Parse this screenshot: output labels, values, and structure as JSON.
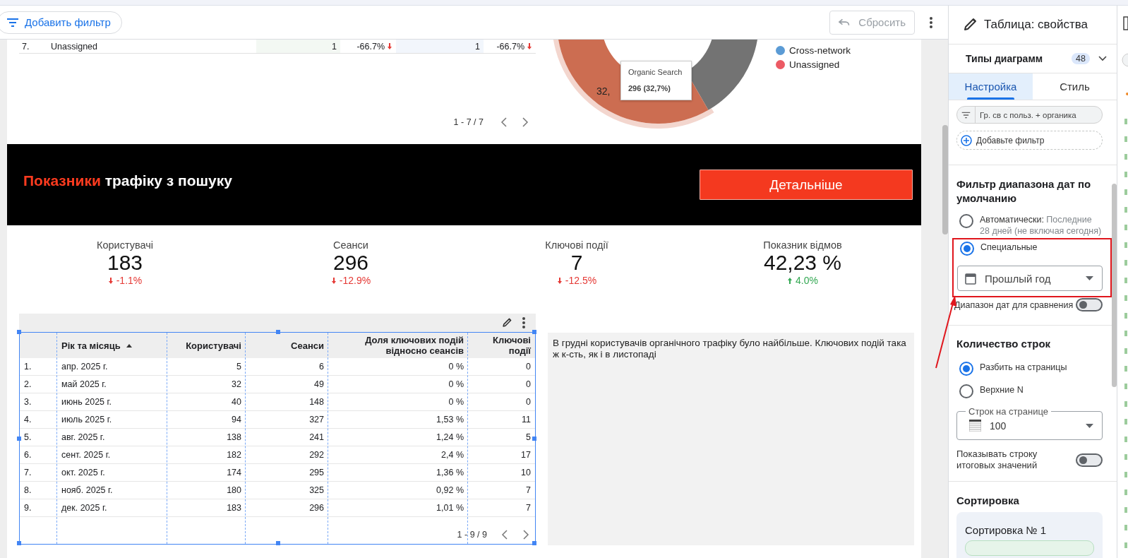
{
  "toolbar": {
    "add_filter": "Добавить фильтр",
    "reset": {
      "label": "Сбросить",
      "disabled": true
    }
  },
  "channel_table": {
    "rows": [
      {
        "index": "7.",
        "channel": "Unassigned",
        "value_1": "1",
        "change_1": "-66.7%",
        "rising_1": false,
        "value_2": "1",
        "change_2": "-66.7%",
        "rising_2": false
      }
    ],
    "pagination": "1 - 7 / 7"
  },
  "donut": {
    "slice_label": "32,",
    "tooltip": {
      "title": "Organic Search",
      "value": "296 (32,7%)"
    },
    "legend": [
      {
        "label": "Cross-network",
        "color": "#5b9bd5"
      },
      {
        "label": "Unassigned",
        "color": "#ec5a64"
      }
    ]
  },
  "banner": {
    "title_accent": "Показники",
    "title_rest": "трафіку з пошуку",
    "button": "Детальніше"
  },
  "scorecards": [
    {
      "label": "Користувачі",
      "value": "183",
      "delta": "-1.1%",
      "rising": false
    },
    {
      "label": "Сеанси",
      "value": "296",
      "delta": "-12.9%",
      "rising": false
    },
    {
      "label": "Ключові події",
      "value": "7",
      "delta": "-12.5%",
      "rising": false
    },
    {
      "label": "Показник відмов",
      "value": "42,23 %",
      "delta": "4.0%",
      "rising": true
    }
  ],
  "table": {
    "selected": true,
    "columns": [
      {
        "label": "Рік та місяць",
        "sorted": true
      },
      {
        "label": "Користувачі",
        "sorted": false
      },
      {
        "label": "Сеанси",
        "sorted": false
      },
      {
        "label": "Доля ключових подій відносно сеансів",
        "sorted": false
      },
      {
        "label": "Ключові події",
        "sorted": false
      }
    ],
    "rows": [
      {
        "index": "1.",
        "cells": [
          "апр. 2025 г.",
          "5",
          "6",
          "0 %",
          "0"
        ]
      },
      {
        "index": "2.",
        "cells": [
          "май 2025 г.",
          "32",
          "49",
          "0 %",
          "0"
        ]
      },
      {
        "index": "3.",
        "cells": [
          "июнь 2025 г.",
          "40",
          "148",
          "0 %",
          "0"
        ]
      },
      {
        "index": "4.",
        "cells": [
          "июль 2025 г.",
          "94",
          "327",
          "1,53 %",
          "11"
        ]
      },
      {
        "index": "5.",
        "cells": [
          "авг. 2025 г.",
          "138",
          "241",
          "1,24 %",
          "5"
        ]
      },
      {
        "index": "6.",
        "cells": [
          "сент. 2025 г.",
          "182",
          "292",
          "2,4 %",
          "17"
        ]
      },
      {
        "index": "7.",
        "cells": [
          "окт. 2025 г.",
          "174",
          "295",
          "1,36 %",
          "10"
        ]
      },
      {
        "index": "8.",
        "cells": [
          "нояб. 2025 г.",
          "180",
          "325",
          "0,92 %",
          "7"
        ]
      },
      {
        "index": "9.",
        "cells": [
          "дек. 2025 г.",
          "183",
          "296",
          "1,01 %",
          "7"
        ]
      }
    ],
    "pagination": "1 - 9 / 9"
  },
  "note": "В грудні користувачів органічного трафіку було найбільше. Ключових подій така ж к-сть, як і в листопаді",
  "panel": {
    "title": "Таблица: свойства",
    "chart_types": {
      "label": "Типы диаграмм",
      "count": "48"
    },
    "tabs": [
      {
        "label": "Настройка",
        "selected": true
      },
      {
        "label": "Стиль",
        "selected": false
      }
    ],
    "filters": {
      "chip": "Гр. св с польз. + органика",
      "add": "Добавьте фильтр"
    },
    "date_range": {
      "heading": "Фильтр диапазона дат по умолчанию",
      "highlight": true,
      "options": [
        {
          "label": "Автоматически:",
          "detail": "Последние 28 дней (не включая сегодня)",
          "selected": false
        },
        {
          "label": "Специальные",
          "selected": true
        }
      ],
      "dropdown": "Прошлый год",
      "compare": {
        "label": "Диапазон дат для сравнения",
        "on": false
      }
    },
    "rows": {
      "heading": "Количество строк",
      "options": [
        {
          "label": "Разбить на страницы",
          "selected": true
        },
        {
          "label": "Верхние N",
          "selected": false
        }
      ],
      "per_page": {
        "label": "Строк на странице",
        "value": "100"
      },
      "totals": {
        "label": "Показывать строку итоговых значений",
        "on": false
      }
    },
    "sorting": {
      "heading": "Сортировка",
      "card": "Сортировка № 1"
    }
  }
}
